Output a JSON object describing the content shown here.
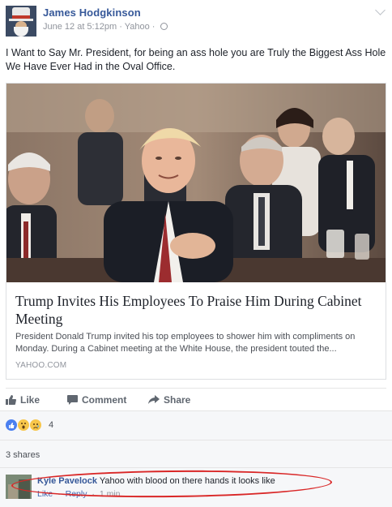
{
  "post": {
    "author": "James Hodgkinson",
    "date": "June 12 at 5:12pm",
    "separator": "·",
    "source_app": "Yahoo",
    "text": "I Want to Say Mr. President, for being an ass hole you are Truly the Biggest Ass Hole We Have Ever Had in the Oval Office."
  },
  "link_card": {
    "title": "Trump Invites His Employees To Praise Him During Cabinet Meeting",
    "description": "President Donald Trump invited his top employees to shower him with compliments on Monday. During a Cabinet meeting at the White House, the president touted the...",
    "source": "YAHOO.COM"
  },
  "actions": {
    "like": "Like",
    "comment": "Comment",
    "share": "Share"
  },
  "reactions": {
    "count": "4",
    "types": [
      "like-icon",
      "wow-icon",
      "sad-icon"
    ]
  },
  "shares": "3 shares",
  "comment": {
    "author": "Kyle Pavelock",
    "text": "Yahoo with blood on there hands it looks like",
    "like": "Like",
    "reply": "Reply",
    "time": "1 min",
    "dot": "·"
  },
  "colors": {
    "link_blue": "#365899",
    "annotation_red": "#d92727",
    "secondary_gray": "#90949c"
  }
}
